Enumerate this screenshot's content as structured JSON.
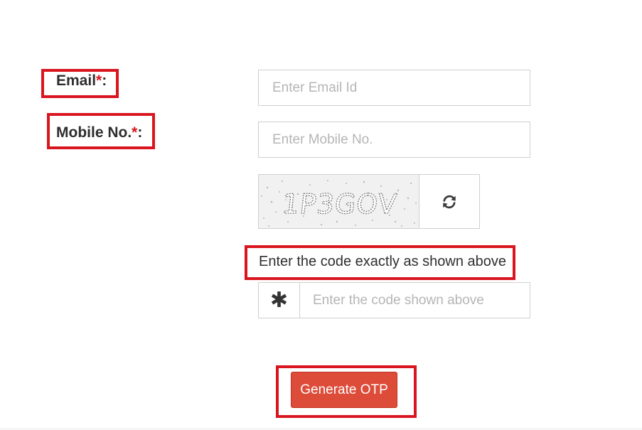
{
  "form": {
    "email": {
      "label": "Email",
      "required_mark": "*",
      "suffix": ":",
      "placeholder": "Enter Email Id",
      "value": ""
    },
    "mobile": {
      "label": "Mobile No.",
      "required_mark": "*",
      "suffix": ":",
      "placeholder": "Enter Mobile No.",
      "value": ""
    },
    "captcha": {
      "image_text": "1P3GOV",
      "refresh_icon": "refresh-icon",
      "hint": "Enter the code exactly as shown above",
      "addon_symbol": "✱",
      "placeholder": "Enter the code shown above",
      "value": ""
    },
    "submit_label": "Generate OTP"
  },
  "colors": {
    "highlight": "#d9161f",
    "button": "#dd4b39",
    "required": "#d9161f"
  }
}
